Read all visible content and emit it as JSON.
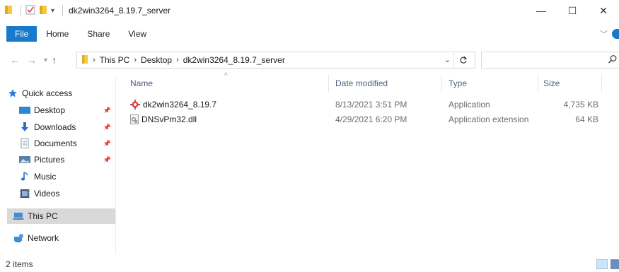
{
  "window": {
    "title": "dk2win3264_8.19.7_server",
    "minimize_glyph": "—",
    "maximize_glyph": "☐",
    "close_glyph": "✕"
  },
  "ribbon": {
    "tabs": [
      "File",
      "Home",
      "Share",
      "View"
    ]
  },
  "nav_buttons": {
    "back": "←",
    "forward": "→",
    "recent": "▾",
    "up": "↑"
  },
  "address": {
    "crumbs": [
      "This PC",
      "Desktop",
      "dk2win3264_8.19.7_server"
    ],
    "separator": "›"
  },
  "search": {
    "value": "",
    "placeholder": ""
  },
  "nav_pane": {
    "items": [
      {
        "label": "Quick access",
        "icon": "star-icon"
      },
      {
        "label": "Desktop",
        "icon": "desktop-icon",
        "pinned": true
      },
      {
        "label": "Downloads",
        "icon": "download-arrow-icon",
        "pinned": true
      },
      {
        "label": "Documents",
        "icon": "document-icon",
        "pinned": true
      },
      {
        "label": "Pictures",
        "icon": "pictures-icon",
        "pinned": true
      },
      {
        "label": "Music",
        "icon": "music-note-icon"
      },
      {
        "label": "Videos",
        "icon": "video-icon"
      },
      {
        "label": "This PC",
        "icon": "computer-icon",
        "selected": true
      },
      {
        "label": "Network",
        "icon": "network-icon"
      }
    ]
  },
  "columns": [
    "Name",
    "Date modified",
    "Type",
    "Size"
  ],
  "files": [
    {
      "name": "dk2win3264_8.19.7",
      "date": "8/13/2021 3:51 PM",
      "type": "Application",
      "size": "4,735 KB",
      "icon": "application-icon"
    },
    {
      "name": "DNSvPm32.dll",
      "date": "4/29/2021 6:20 PM",
      "type": "Application extension",
      "size": "64 KB",
      "icon": "dll-file-icon"
    }
  ],
  "status": {
    "item_count": "2 items"
  },
  "colors": {
    "accent": "#1979ca",
    "header_text": "#4c607a",
    "folder": "#f6c940",
    "selected_bg": "#d9d9d9"
  }
}
